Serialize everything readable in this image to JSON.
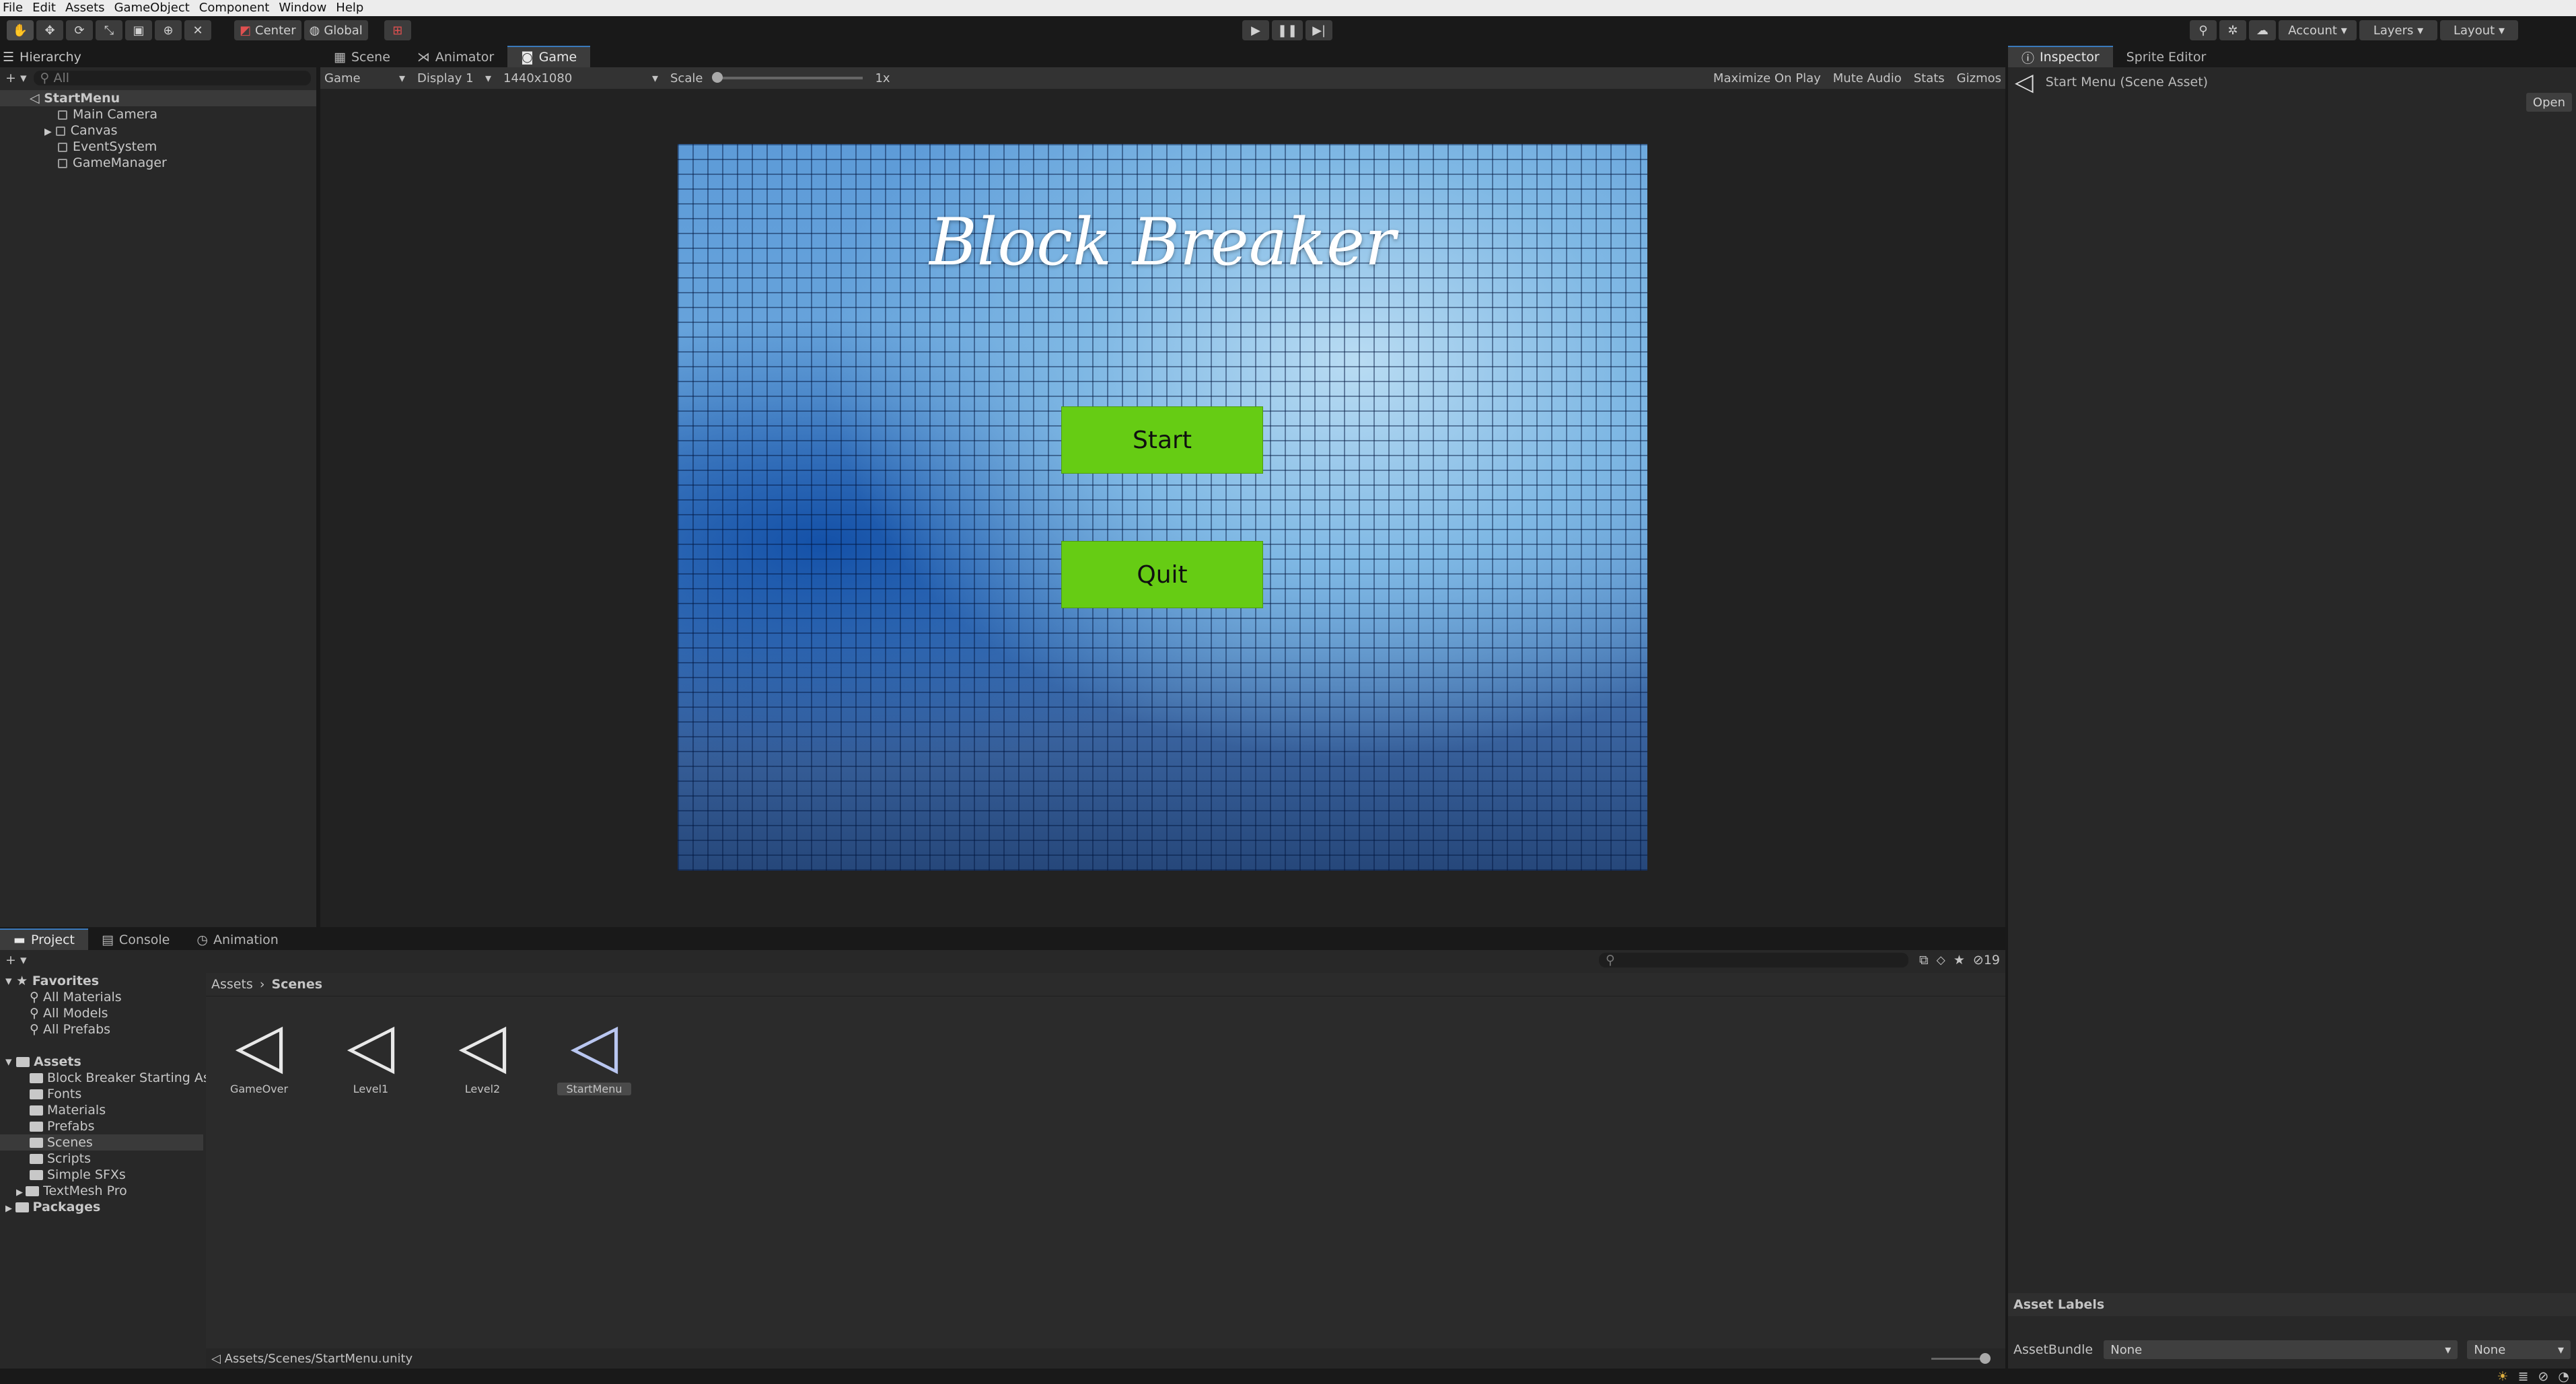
{
  "menubar": {
    "items": [
      "File",
      "Edit",
      "Assets",
      "GameObject",
      "Component",
      "Window",
      "Help"
    ]
  },
  "toolbar": {
    "pivot_label": "Center",
    "space_label": "Global",
    "account_label": "Account",
    "layers_label": "Layers",
    "layout_label": "Layout"
  },
  "hierarchy": {
    "tab_label": "Hierarchy",
    "search_placeholder": "All",
    "scene_name": "StartMenu",
    "objects": [
      "Main Camera",
      "Canvas",
      "EventSystem",
      "GameManager"
    ]
  },
  "center_tabs": [
    "Scene",
    "Animator",
    "Game"
  ],
  "game_bar": {
    "mode": "Game",
    "display": "Display 1",
    "resolution": "1440x1080",
    "scale_label": "Scale",
    "scale_value": "1x",
    "maximize": "Maximize On Play",
    "mute": "Mute Audio",
    "stats": "Stats",
    "gizmos": "Gizmos"
  },
  "game": {
    "title": "Block Breaker",
    "start_label": "Start",
    "quit_label": "Quit"
  },
  "inspector": {
    "tab_label": "Inspector",
    "sprite_tab": "Sprite Editor",
    "asset_title": "Start Menu (Scene Asset)",
    "open_label": "Open",
    "asset_labels": "Asset Labels",
    "assetbundle_label": "AssetBundle",
    "bundle_value": "None",
    "variant_value": "None"
  },
  "bottom_tabs": [
    "Project",
    "Console",
    "Animation"
  ],
  "project": {
    "favorites_label": "Favorites",
    "favorites": [
      "All Materials",
      "All Models",
      "All Prefabs"
    ],
    "assets_label": "Assets",
    "folders": [
      "Block Breaker Starting Asse",
      "Fonts",
      "Materials",
      "Prefabs",
      "Scenes",
      "Scripts",
      "Simple SFXs",
      "TextMesh Pro"
    ],
    "packages_label": "Packages",
    "breadcrumb_root": "Assets",
    "breadcrumb_current": "Scenes",
    "scenes": [
      "GameOver",
      "Level1",
      "Level2",
      "StartMenu"
    ],
    "count": "19",
    "status_path": "Assets/Scenes/StartMenu.unity"
  }
}
